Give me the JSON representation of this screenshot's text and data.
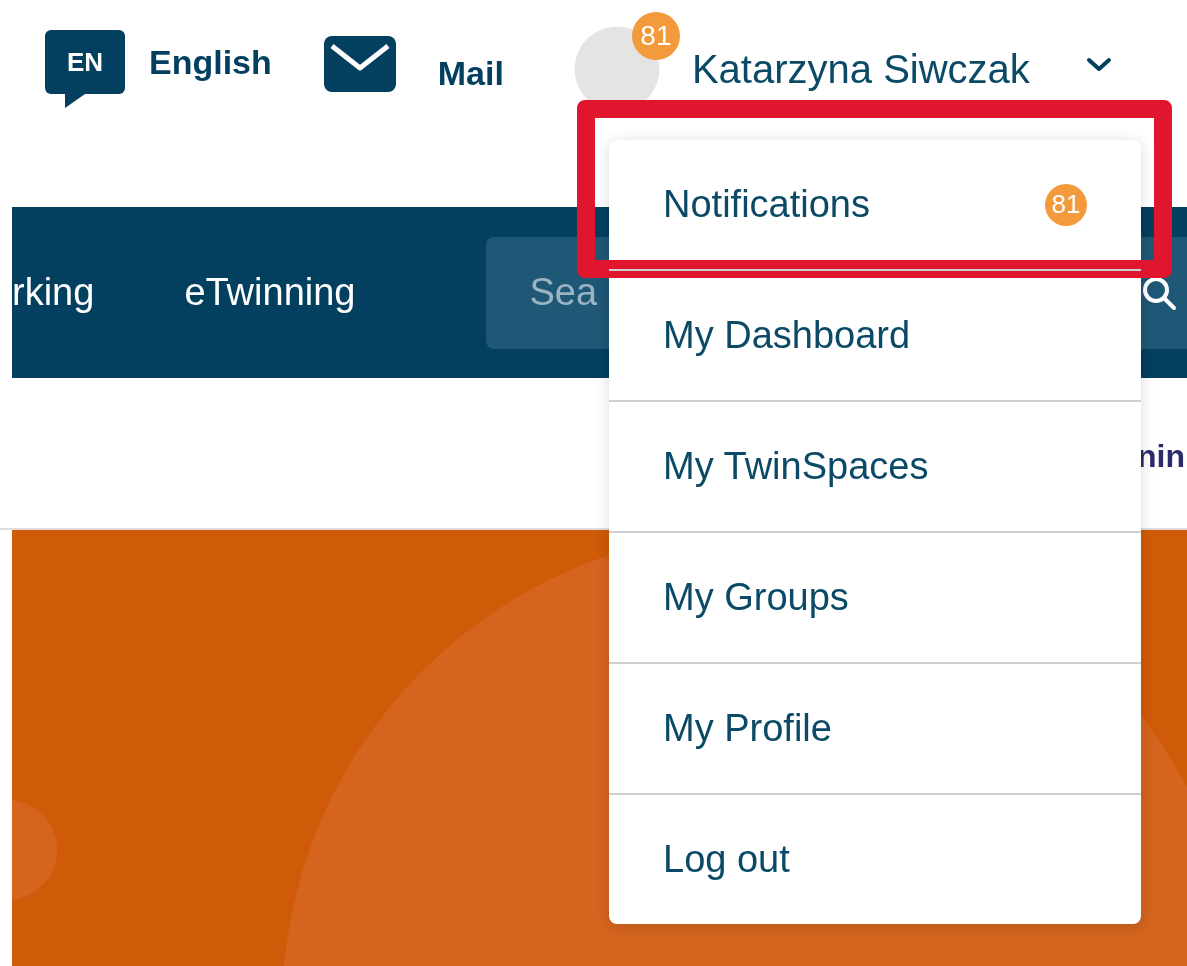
{
  "header": {
    "language": {
      "code": "EN",
      "label": "English"
    },
    "mail": {
      "label": "Mail"
    },
    "user": {
      "name": "Katarzyna Siwczak",
      "badge": "81"
    }
  },
  "nav": {
    "items": [
      "rking",
      "eTwinning"
    ],
    "search": {
      "placeholder": "Sea"
    }
  },
  "subnav": {
    "text": "nin"
  },
  "user_menu": {
    "items": [
      {
        "label": "Notifications",
        "badge": "81",
        "highlighted": true
      },
      {
        "label": "My Dashboard",
        "highlighted": false
      },
      {
        "label": "My TwinSpaces",
        "highlighted": false
      },
      {
        "label": "My Groups",
        "highlighted": false
      },
      {
        "label": "My Profile",
        "highlighted": false
      },
      {
        "label": "Log out",
        "highlighted": false
      }
    ]
  }
}
